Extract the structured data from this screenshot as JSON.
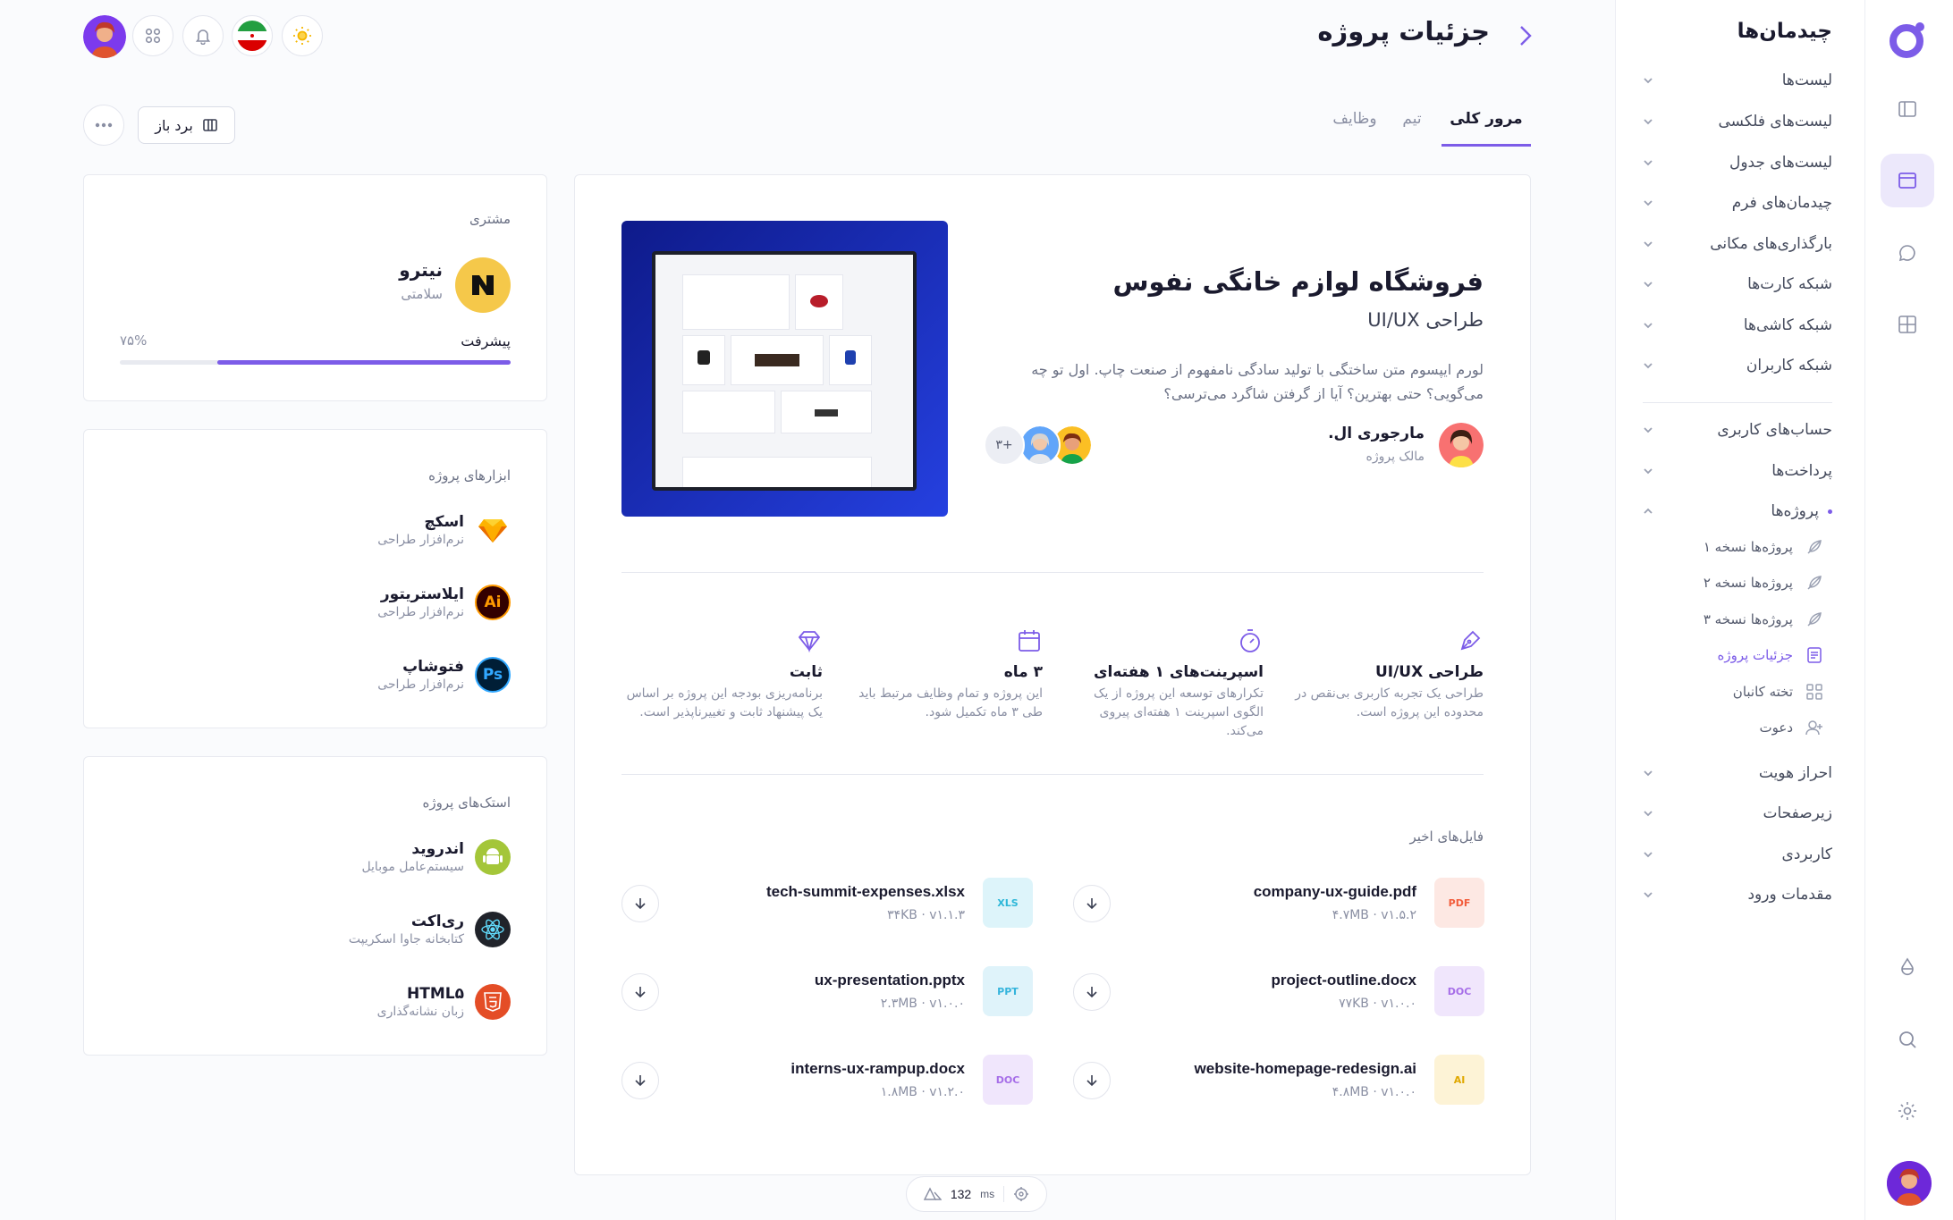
{
  "header": {
    "title": "جزئیات پروژه"
  },
  "tabs": [
    {
      "label": "مرور کلی",
      "active": true
    },
    {
      "label": "تیم",
      "active": false
    },
    {
      "label": "وظایف",
      "active": false
    }
  ],
  "toolbar": {
    "open_board_label": "برد باز"
  },
  "nav": {
    "title": "چیدمان‌ها",
    "items": [
      {
        "label": "لیست‌ها"
      },
      {
        "label": "لیست‌های فلکسی"
      },
      {
        "label": "لیست‌های جدول"
      },
      {
        "label": "چیدمان‌های فرم"
      },
      {
        "label": "بارگذاری‌های مکانی"
      },
      {
        "label": "شبکه کارت‌ها"
      },
      {
        "label": "شبکه کاشی‌ها"
      },
      {
        "label": "شبکه کاربران"
      }
    ],
    "items2": [
      {
        "label": "حساب‌های کاربری"
      },
      {
        "label": "پرداخت‌ها"
      },
      {
        "label": "پروژه‌ها"
      }
    ],
    "sub": [
      {
        "label": "پروژه‌ها نسخه ۱",
        "icon": "leaf-icon"
      },
      {
        "label": "پروژه‌ها نسخه ۲",
        "icon": "leaf-icon"
      },
      {
        "label": "پروژه‌ها نسخه ۳",
        "icon": "leaf-icon"
      },
      {
        "label": "جزئیات پروژه",
        "icon": "document-icon",
        "active": true
      },
      {
        "label": "تخته کانبان",
        "icon": "grid-icon"
      },
      {
        "label": "دعوت",
        "icon": "user-plus-icon"
      }
    ],
    "items3": [
      {
        "label": "احراز هویت"
      },
      {
        "label": "زیرصفحات"
      },
      {
        "label": "کاربردی"
      },
      {
        "label": "مقدمات ورود"
      }
    ]
  },
  "project": {
    "title": "فروشگاه لوازم خانگی نفوس",
    "subtitle": "طراحی UI/UX",
    "description": "لورم ایپسوم متن ساختگی با تولید سادگی نامفهوم از صنعت چاپ. اول تو چه می‌گویی؟ حتی بهترین؟ آیا از گرفتن شاگرد می‌ترسی؟",
    "owner_name": "مارجوری ال.",
    "owner_role": "مالک پروژه",
    "members_more": "۳+"
  },
  "features": [
    {
      "title": "طراحی UI/UX",
      "desc": "طراحی یک تجربه کاربری بی‌نقص در محدوده این پروژه است.",
      "icon": "pen-icon"
    },
    {
      "title": "اسپرینت‌های ۱ هفته‌ای",
      "desc": "تکرارهای توسعه این پروژه از یک الگوی اسپرینت ۱ هفته‌ای پیروی می‌کند.",
      "icon": "timer-icon"
    },
    {
      "title": "۳ ماه",
      "desc": "این پروژه و تمام وظایف مرتبط باید طی ۳ ماه تکمیل شود.",
      "icon": "calendar-icon"
    },
    {
      "title": "ثابت",
      "desc": "برنامه‌ریزی بودجه این پروژه بر اساس یک پیشنهاد ثابت و تغییرناپذیر است.",
      "icon": "diamond-icon"
    }
  ],
  "files": {
    "title": "فایل‌های اخیر",
    "items": [
      {
        "name": "company-ux-guide.pdf",
        "meta": "۴.۷MB · v۱.۵.۲",
        "type": "PDF",
        "color": "#f25c3b",
        "bg": "#fde8e3"
      },
      {
        "name": "tech-summit-expenses.xlsx",
        "meta": "۳۴KB · v۱.۱.۳",
        "type": "XLS",
        "color": "#2db7d8",
        "bg": "#ddf4fa"
      },
      {
        "name": "project-outline.docx",
        "meta": "۷۷KB · v۱.۰.۰",
        "type": "DOC",
        "color": "#a66ee8",
        "bg": "#f0e6fc"
      },
      {
        "name": "ux-presentation.pptx",
        "meta": "۲.۳MB · v۱.۰.۰",
        "type": "PPT",
        "color": "#35b4dc",
        "bg": "#dff3fa"
      },
      {
        "name": "website-homepage-redesign.ai",
        "meta": "۴.۸MB · v۱.۰.۰",
        "type": "AI",
        "color": "#f5b700",
        "bg": "#fdf3d6"
      },
      {
        "name": "interns-ux-rampup.docx",
        "meta": "۱.۸MB · v۱.۲.۰",
        "type": "DOC",
        "color": "#a66ee8",
        "bg": "#f0e6fc"
      }
    ]
  },
  "client": {
    "label": "مشتری",
    "name": "نیترو",
    "sub": "سلامتی",
    "progress_label": "پیشرفت",
    "progress_text": "۷۵%",
    "progress": 0.75
  },
  "tools": {
    "title": "ابزارهای پروژه",
    "items": [
      {
        "name": "اسکچ",
        "sub": "نرم‌افزار طراحی",
        "icon": "sketch-icon"
      },
      {
        "name": "ایلاستریتور",
        "sub": "نرم‌افزار طراحی",
        "icon": "illustrator-icon",
        "abbr": "Ai"
      },
      {
        "name": "فتوشاپ",
        "sub": "نرم‌افزار طراحی",
        "icon": "photoshop-icon",
        "abbr": "Ps"
      }
    ]
  },
  "stacks": {
    "title": "استک‌های پروژه",
    "items": [
      {
        "name": "اندروید",
        "sub": "سیستم‌عامل موبایل",
        "icon": "android-icon"
      },
      {
        "name": "ری‌اکت",
        "sub": "کتابخانه جاوا اسکریپت",
        "icon": "react-icon"
      },
      {
        "name": "HTML۵",
        "sub": "زبان نشانه‌گذاری",
        "icon": "html5-icon"
      }
    ]
  },
  "perf": {
    "value": "132",
    "unit": "ms"
  },
  "colors": {
    "accent": "#7c5ce8",
    "purple_dark": "#6c47ff"
  }
}
